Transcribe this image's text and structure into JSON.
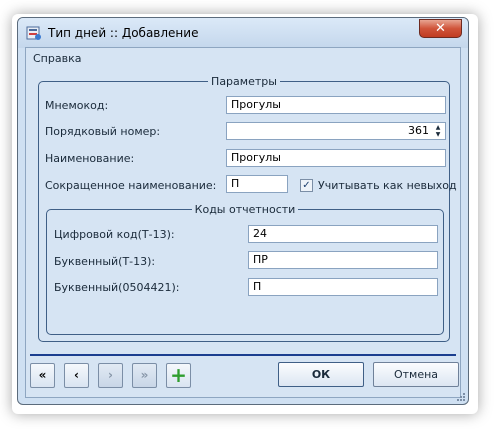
{
  "window": {
    "title": "Тип дней :: Добавление",
    "close_glyph": "✕"
  },
  "menu": {
    "help": "Справка"
  },
  "params": {
    "legend": "Параметры",
    "mnemocode_label": "Мнемокод:",
    "mnemocode_value": "Прогулы",
    "order_label": "Порядковый номер:",
    "order_value": "361",
    "name_label": "Наименование:",
    "name_value": "Прогулы",
    "short_label": "Сокращенное наименование:",
    "short_value": "П",
    "count_as_dayoff_label": "Учитывать как невыход",
    "count_as_dayoff_checked": true
  },
  "codes": {
    "legend": "Коды отчетности",
    "digital_label": "Цифровой код(Т-13):",
    "digital_value": "24",
    "letter_t13_label": "Буквенный(Т-13):",
    "letter_t13_value": "ПР",
    "letter_0504421_label": "Буквенный(0504421):",
    "letter_0504421_value": "П"
  },
  "nav": {
    "first": "«",
    "prev": "‹",
    "next": "›",
    "last": "»",
    "add": "+"
  },
  "buttons": {
    "ok": "ОК",
    "cancel": "Отмена"
  },
  "colors": {
    "add_icon": "#2f9e2f",
    "separator": "#1b3e8f"
  }
}
